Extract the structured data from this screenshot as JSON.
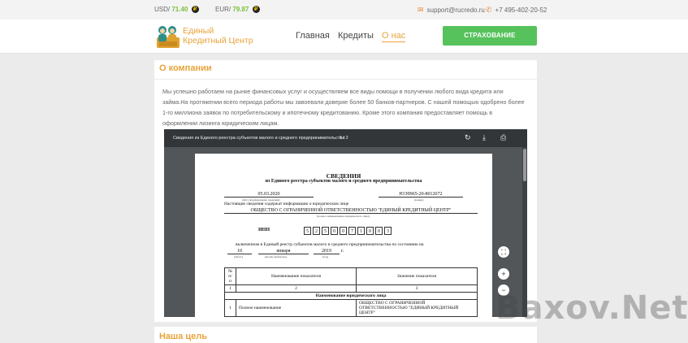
{
  "topbar": {
    "usd_label": "USD/",
    "usd_value": "71.40",
    "eur_label": "EUR/",
    "eur_value": "79.87",
    "currency_symbol": "₽",
    "email": "support@rucredo.ru",
    "phone": "+7 495-402-20-52"
  },
  "header": {
    "logo_line1": "Единый",
    "logo_line2": "Кредитный Центр",
    "nav": [
      "Главная",
      "Кредиты",
      "О нас"
    ],
    "active_nav": "О нас",
    "insurance_button": "СТРАХОВАНИЕ"
  },
  "about": {
    "title": "О компании",
    "text": "Мы успешно работаем на рынке финансовых услуг и осуществляем все виды помощи в получении любого вида кредита или займа.На протяжении всего периода работы мы завоевали доверие более 50 банков-партнеров. С нашей помощью одобрено более 1-го миллиона заявок по потребительскому и ипотечному кредитованию. Кроме этого компания предоставляет помощь в оформлении лизинга юридическим лицам."
  },
  "viewer": {
    "title": "Сведения из Единого реестра субъектов малого и среднего предпринимательства",
    "pages": "1 / 2",
    "icons": [
      "rotate-icon",
      "download-icon",
      "print-icon",
      "fit-page-icon",
      "zoom-in-icon",
      "zoom-out-icon"
    ]
  },
  "document": {
    "heading": "СВЕДЕНИЯ",
    "subheading": "из Единого реестра субъектов малого и среднего предпринимательства",
    "date": "05.03.2020",
    "date_caption": "(Дата формирования сведений)",
    "number": "ЮЭ9965-20-8012672",
    "number_caption": "(номер)",
    "contains": "Настоящие сведения содержат информацию о юридическом лице",
    "company": "ОБЩЕСТВО С ОГРАНИЧЕННОЙ ОТВЕТСТВЕННОСТЬЮ \"ЕДИНЫЙ КРЕДИТНЫЙ ЦЕНТР\"",
    "company_caption": "(полное наименование юридического лица)",
    "inn_label": "ИНН",
    "inn_digits": [
      "5",
      "2",
      "5",
      "0",
      "0",
      "7",
      "1",
      "0",
      "0",
      "3"
    ],
    "included": "включенном в Единый реестр субъектов малого и среднего предпринимательства по состоянию на",
    "day": "10",
    "day_caption": "(число)",
    "month": "января",
    "month_caption": "(месяц прописью)",
    "year": "2019",
    "year_suffix": "г.",
    "year_caption": "(год)",
    "table_headers": [
      "№ п/п",
      "Наименование показателя",
      "Значение показателя"
    ],
    "table_numbers": [
      "1",
      "2",
      "3"
    ],
    "section": "Наименование юридического лица",
    "row1_label": "Полное наименование",
    "row1_value": "ОБЩЕСТВО С ОГРАНИЧЕННОЙ ОТВЕТСТВЕННОСТЬЮ \"ЕДИНЫЙ КРЕДИТНЫЙ ЦЕНТР\"",
    "row1_no": "1"
  },
  "next_section": {
    "title": "Наша цель"
  },
  "watermark": "Baxov.Net",
  "colors": {
    "accent": "#e8a33a",
    "green": "#56c25c",
    "usd": "#7cbf3d"
  }
}
